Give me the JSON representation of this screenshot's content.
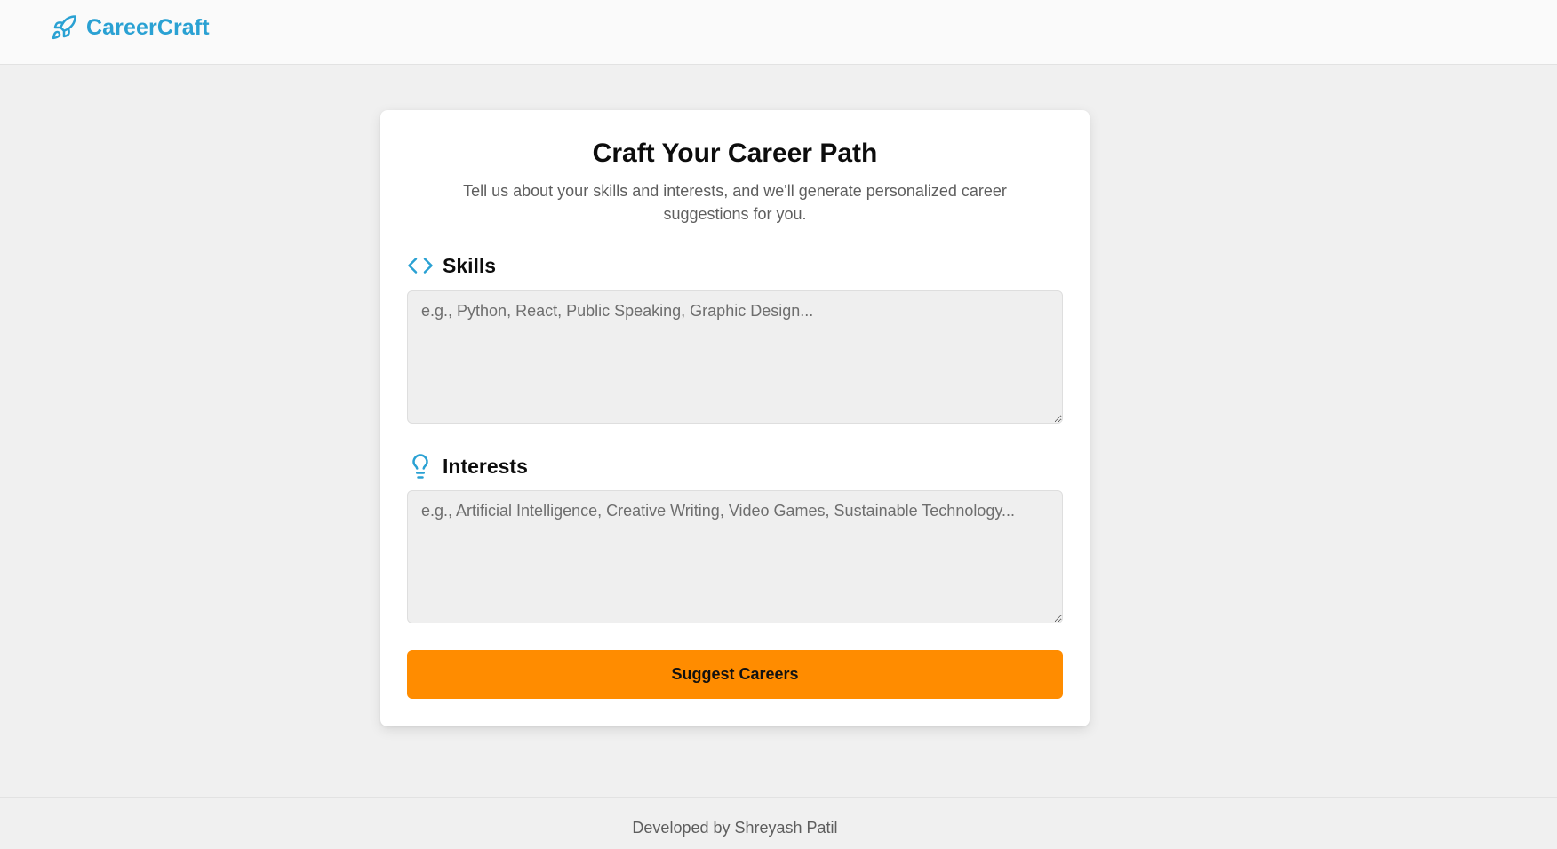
{
  "header": {
    "brand_name": "CareerCraft",
    "brand_icon": "rocket-icon",
    "brand_color": "#2aa1d3"
  },
  "form": {
    "title": "Craft Your Career Path",
    "subtitle": "Tell us about your skills and interests, and we'll generate personalized career suggestions for you.",
    "skills": {
      "label": "Skills",
      "icon": "code-icon",
      "value": "",
      "placeholder": "e.g., Python, React, Public Speaking, Graphic Design..."
    },
    "interests": {
      "label": "Interests",
      "icon": "lightbulb-icon",
      "value": "",
      "placeholder": "e.g., Artificial Intelligence, Creative Writing, Video Games, Sustainable Technology..."
    },
    "submit_label": "Suggest Careers",
    "accent_color": "#ff8c00"
  },
  "footer": {
    "text": "Developed by Shreyash Patil"
  }
}
